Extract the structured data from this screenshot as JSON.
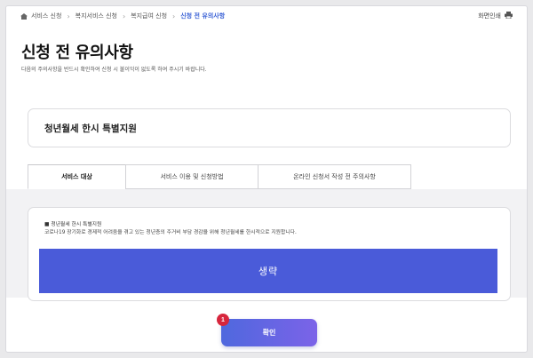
{
  "breadcrumb": {
    "items": [
      "서비스 신청",
      "복지서비스 신청",
      "복지급여 신청"
    ],
    "current": "신청 전 유의사항"
  },
  "toolbar": {
    "print_label": "화면인쇄"
  },
  "page": {
    "title": "신청 전 유의사항",
    "subtitle": "다음의 주의사항을 반드시 확인하여 신청 시 불이익이 없도록 하여 주시기 바랍니다."
  },
  "service": {
    "name": "청년월세 한시 특별지원"
  },
  "tabs": [
    {
      "label": "서비스 대상",
      "active": true
    },
    {
      "label": "서비스 이용 및 신청방법",
      "active": false
    },
    {
      "label": "온라인 신청서 작성 전 주의사항",
      "active": false
    }
  ],
  "content": {
    "heading": "■ 청년월세 한시 특별지원",
    "description": "코로나19 장기화로 경제적 어려움을 겪고 있는 청년층의 주거비 부담 경감을 위해 청년월세를 한시적으로 지원합니다.",
    "omitted_label": "생략"
  },
  "actions": {
    "confirm_label": "확인",
    "badge": "1"
  },
  "colors": {
    "accent": "#3b62d6",
    "omit_bg": "#4a5bd9",
    "badge": "#d7263d"
  },
  "icons": {
    "home": "home-icon",
    "print": "printer-icon"
  }
}
